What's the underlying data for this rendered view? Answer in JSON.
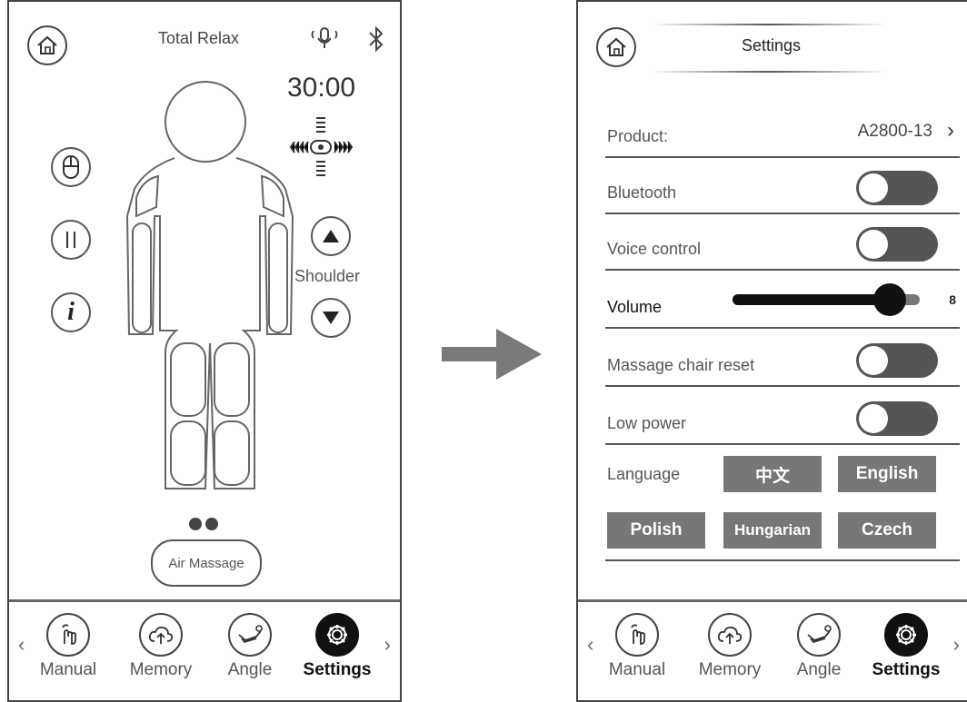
{
  "left": {
    "title": "Total Relax",
    "timer": "30:00",
    "shoulder_label": "Shoulder",
    "air_massage_label": "Air Massage",
    "icons": [
      "home-icon",
      "voice-icon",
      "bluetooth-icon",
      "position-adjust-icon",
      "mouse-icon",
      "pause-icon",
      "info-icon",
      "up-arrow-icon",
      "down-arrow-icon"
    ]
  },
  "right": {
    "title": "Settings",
    "product_label": "Product:",
    "product_value": "A2800-13",
    "bluetooth_label": "Bluetooth",
    "voice_label": "Voice control",
    "volume_label": "Volume",
    "volume_value": "8",
    "reset_label": "Massage chair reset",
    "low_power_label": "Low power",
    "language_label": "Language",
    "languages": [
      "中文",
      "English",
      "Polish",
      "Hungarian",
      "Czech"
    ],
    "volume_fraction": 0.84
  },
  "tabs": [
    {
      "label": "Manual",
      "icon": "hand-icon"
    },
    {
      "label": "Memory",
      "icon": "cloud-upload-icon"
    },
    {
      "label": "Angle",
      "icon": "recline-icon"
    },
    {
      "label": "Settings",
      "icon": "gear-icon",
      "active": true
    }
  ],
  "colors": {
    "toggle_off": "#555555",
    "lang_button": "#777777",
    "active_tab": "#111111"
  }
}
